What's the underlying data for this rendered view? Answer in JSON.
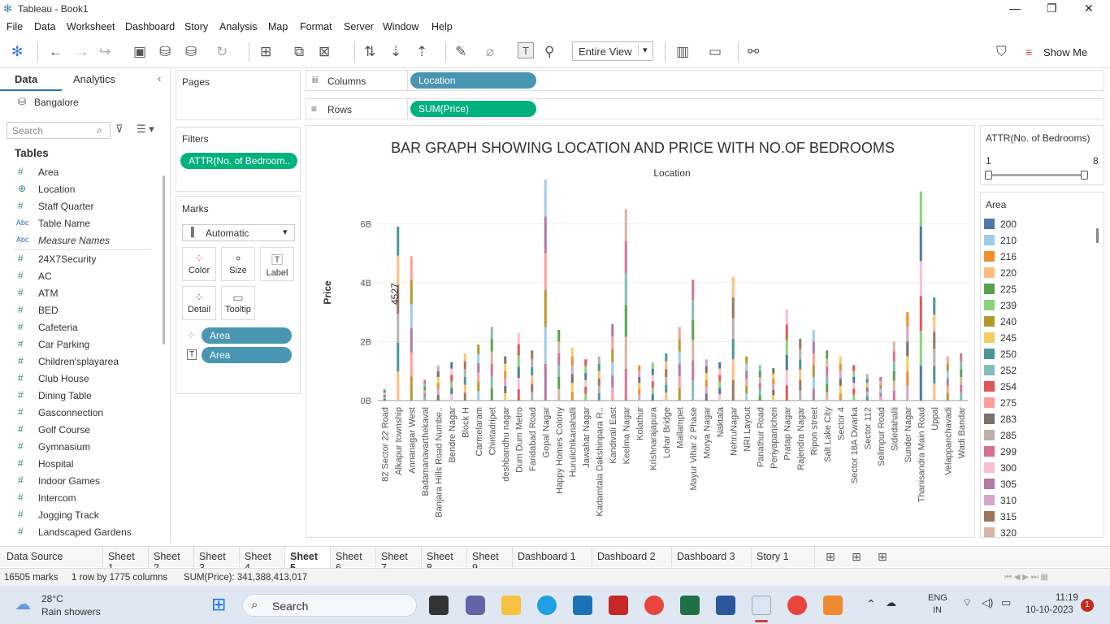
{
  "window": {
    "title": "Tableau - Book1"
  },
  "menu": [
    "File",
    "Data",
    "Worksheet",
    "Dashboard",
    "Story",
    "Analysis",
    "Map",
    "Format",
    "Server",
    "Window",
    "Help"
  ],
  "toolbar": {
    "view_mode": "Entire View",
    "show_me": "Show Me"
  },
  "left_panel": {
    "tab_data": "Data",
    "tab_analytics": "Analytics",
    "datasource": "Bangalore",
    "search_placeholder": "Search",
    "tables_heading": "Tables",
    "fields": [
      {
        "icon": "#",
        "name": "Area"
      },
      {
        "icon": "⊕",
        "name": "Location"
      },
      {
        "icon": "#",
        "name": "Staff Quarter"
      },
      {
        "icon": "Abc",
        "name": "Table Name"
      },
      {
        "icon": "Abc",
        "name": "Measure Names"
      },
      {
        "icon": "#",
        "name": "24X7Security"
      },
      {
        "icon": "#",
        "name": "AC"
      },
      {
        "icon": "#",
        "name": "ATM"
      },
      {
        "icon": "#",
        "name": "BED"
      },
      {
        "icon": "#",
        "name": "Cafeteria"
      },
      {
        "icon": "#",
        "name": "Car Parking"
      },
      {
        "icon": "#",
        "name": "Children'splayarea"
      },
      {
        "icon": "#",
        "name": "Club House"
      },
      {
        "icon": "#",
        "name": "Dining Table"
      },
      {
        "icon": "#",
        "name": "Gasconnection"
      },
      {
        "icon": "#",
        "name": "Golf Course"
      },
      {
        "icon": "#",
        "name": "Gymnasium"
      },
      {
        "icon": "#",
        "name": "Hospital"
      },
      {
        "icon": "#",
        "name": "Indoor Games"
      },
      {
        "icon": "#",
        "name": "Intercom"
      },
      {
        "icon": "#",
        "name": "Jogging Track"
      },
      {
        "icon": "#",
        "name": "Landscaped Gardens"
      }
    ]
  },
  "shelves": {
    "pages_label": "Pages",
    "filters_label": "Filters",
    "filter_pill": "ATTR(No. of Bedroom..",
    "marks_label": "Marks",
    "marks_type": "Automatic",
    "mark_buttons": [
      "Color",
      "Size",
      "Label",
      "Detail",
      "Tooltip"
    ],
    "marks_pills": [
      "Area",
      "Area"
    ],
    "columns_label": "Columns",
    "columns_pill": "Location",
    "rows_label": "Rows",
    "rows_pill": "SUM(Price)"
  },
  "filter_card": {
    "title": "ATTR(No. of Bedrooms)",
    "min": "1",
    "max": "8"
  },
  "legend": {
    "title": "Area",
    "items": [
      {
        "label": "200",
        "color": "#4e79a7"
      },
      {
        "label": "210",
        "color": "#a0cbe8"
      },
      {
        "label": "216",
        "color": "#f28e2b"
      },
      {
        "label": "220",
        "color": "#ffbe7d"
      },
      {
        "label": "225",
        "color": "#59a14f"
      },
      {
        "label": "239",
        "color": "#8cd17d"
      },
      {
        "label": "240",
        "color": "#b6992d"
      },
      {
        "label": "245",
        "color": "#f1ce63"
      },
      {
        "label": "250",
        "color": "#499894"
      },
      {
        "label": "252",
        "color": "#86bcb6"
      },
      {
        "label": "254",
        "color": "#e15759"
      },
      {
        "label": "275",
        "color": "#ff9d9a"
      },
      {
        "label": "283",
        "color": "#79706e"
      },
      {
        "label": "285",
        "color": "#bab0ac"
      },
      {
        "label": "299",
        "color": "#d37295"
      },
      {
        "label": "300",
        "color": "#fabfd2"
      },
      {
        "label": "305",
        "color": "#b07aa1"
      },
      {
        "label": "310",
        "color": "#d4a6c8"
      },
      {
        "label": "315",
        "color": "#9d7660"
      },
      {
        "label": "320",
        "color": "#d7b5a6"
      }
    ]
  },
  "chart_data": {
    "type": "bar",
    "title": "BAR GRAPH SHOWING LOCATION AND PRICE WITH NO.OF BEDROOMS",
    "top_axis_label": "Location",
    "ylabel": "Price",
    "yticks": [
      "0B",
      "2B",
      "4B",
      "6B"
    ],
    "ylim": [
      0,
      7500000000
    ],
    "annotation": "4527",
    "categories": [
      "82 Sector 22 Road",
      "Alkapur township",
      "Annanagar West",
      "Badamanavarthekaval",
      "Banjara Hills Road Numbe..",
      "Bendre Nagar",
      "Block H",
      "Carmelaram",
      "Chintadripet",
      "deshbandhu nagar",
      "Dum Dum Metro",
      "Faridabad Road",
      "Gopal Nagar",
      "Happy Homes Colony",
      "Hurulichikanahalli",
      "Jawahar Nagar",
      "Kadamtala Dakshinpara R..",
      "Kandivali East",
      "Keelma Nagar",
      "Kolathur",
      "Krishnarajapura",
      "Lohar Bridge",
      "Mallampet",
      "Mayur Vihar 2 Phase",
      "Morya Nagar",
      "Naktala",
      "NehruNagar",
      "NRI Layout",
      "Panathur Road",
      "Periyapanicheri",
      "Pratap Nagar",
      "Rajendra Nagar",
      "Ripon street",
      "Salt Lake City",
      "Sector 4",
      "Sector 18A Dwarka",
      "Sector 112",
      "Selimpur Road",
      "Sidedahalli",
      "Sunder Nagar",
      "Thanisandra Main Road",
      "Uppal",
      "Velappanchavadi",
      "Wadi Bandar"
    ],
    "values": [
      400000000,
      5900000000,
      4900000000,
      700000000,
      1200000000,
      1300000000,
      1600000000,
      1900000000,
      2500000000,
      1500000000,
      2300000000,
      1700000000,
      7500000000,
      2400000000,
      1800000000,
      1400000000,
      1500000000,
      2600000000,
      6500000000,
      1200000000,
      1300000000,
      1600000000,
      2500000000,
      4100000000,
      1400000000,
      1300000000,
      4200000000,
      1500000000,
      1200000000,
      1100000000,
      3100000000,
      2100000000,
      2400000000,
      1700000000,
      1500000000,
      1200000000,
      900000000,
      800000000,
      2000000000,
      3000000000,
      7100000000,
      3500000000,
      1500000000,
      1600000000
    ]
  },
  "sheet_tabs": [
    "Data Source",
    "Sheet 1",
    "Sheet 2",
    "Sheet 3",
    "Sheet 4",
    "Sheet 5",
    "Sheet 6",
    "Sheet 7",
    "Sheet 8",
    "Sheet 9",
    "Dashboard 1",
    "Dashboard 2",
    "Dashboard 3",
    "Story 1"
  ],
  "active_tab": "Sheet 5",
  "status": {
    "marks": "16505 marks",
    "dims": "1 row by 1775 columns",
    "sum": "SUM(Price): 341,388,413,017"
  },
  "taskbar": {
    "weather_temp": "28°C",
    "weather_desc": "Rain showers",
    "search": "Search",
    "lang1": "ENG",
    "lang2": "IN",
    "time": "11:19",
    "date": "10-10-2023",
    "notif": "1"
  }
}
